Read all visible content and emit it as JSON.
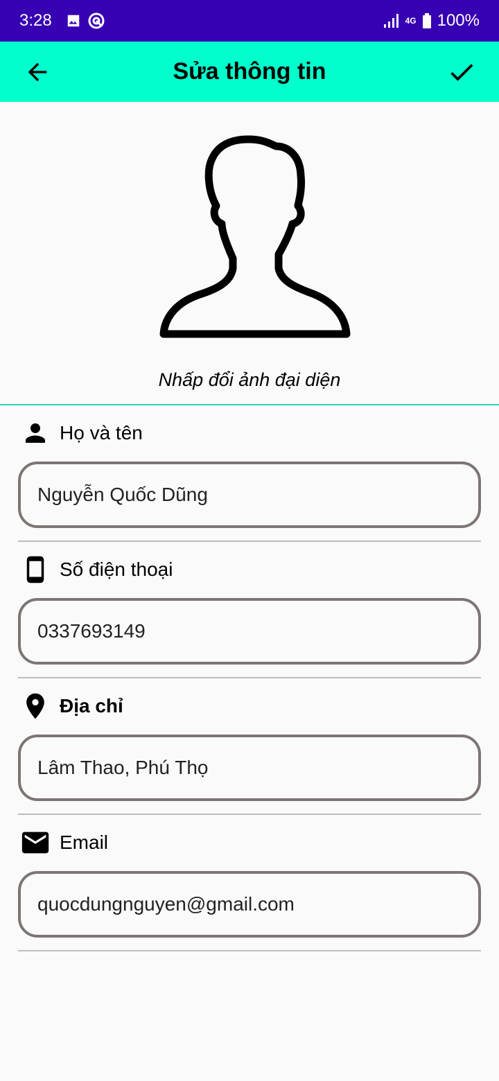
{
  "status_bar": {
    "time": "3:28",
    "network": "4G",
    "battery": "100%"
  },
  "app_bar": {
    "title": "Sửa thông tin"
  },
  "avatar": {
    "caption": "Nhấp đổi ảnh đại diện"
  },
  "fields": [
    {
      "label": "Họ và tên",
      "value": "Nguyễn Quốc Dũng",
      "icon": "person-icon"
    },
    {
      "label": "Số điện thoại",
      "value": "0337693149",
      "icon": "phone-icon"
    },
    {
      "label": "Địa chỉ",
      "value": "Lâm Thao, Phú Thọ",
      "icon": "location-icon"
    },
    {
      "label": "Email",
      "value": "quocdungnguyen@gmail.com",
      "icon": "email-icon"
    }
  ],
  "colors": {
    "status_bar": "#3700b3",
    "app_bar": "#00ffcc",
    "input_border": "#7d7574",
    "accent_line": "#2fd6c0"
  }
}
